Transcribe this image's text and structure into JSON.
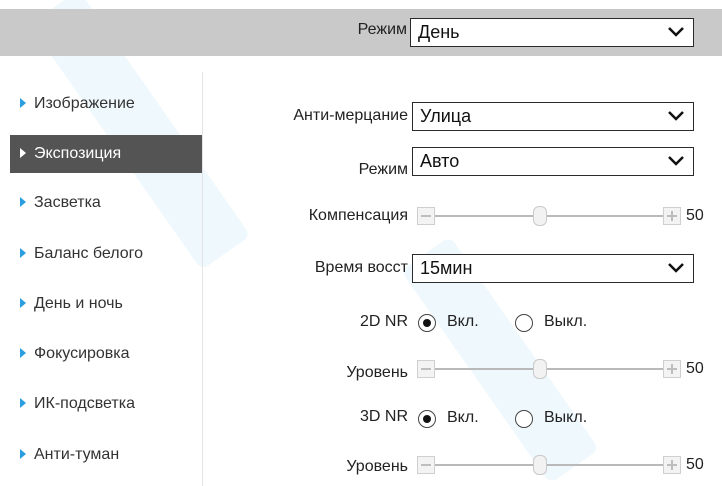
{
  "top": {
    "mode_label": "Режим",
    "mode_value": "День"
  },
  "sidebar": {
    "items": [
      {
        "label": "Изображение",
        "active": false
      },
      {
        "label": "Экспозиция",
        "active": true
      },
      {
        "label": "Засветка",
        "active": false
      },
      {
        "label": "Баланс белого",
        "active": false
      },
      {
        "label": "День и ночь",
        "active": false
      },
      {
        "label": "Фокусировка",
        "active": false
      },
      {
        "label": "ИК-подсветка",
        "active": false
      },
      {
        "label": "Анти-туман",
        "active": false
      }
    ]
  },
  "form": {
    "anti_flicker": {
      "label": "Анти-мерцание",
      "value": "Улица"
    },
    "mode": {
      "label": "Режим",
      "value": "Авто"
    },
    "compensation": {
      "label": "Компенсация",
      "value": "50",
      "level": 50
    },
    "recovery_time": {
      "label": "Время восст",
      "value": "15мин"
    },
    "nr2d": {
      "label": "2D NR",
      "on_label": "Вкл.",
      "off_label": "Выкл.",
      "selected": "on"
    },
    "nr2d_level": {
      "label": "Уровень",
      "value": "50",
      "level": 50
    },
    "nr3d": {
      "label": "3D NR",
      "on_label": "Вкл.",
      "off_label": "Выкл.",
      "selected": "on"
    },
    "nr3d_level": {
      "label": "Уровень",
      "value": "50",
      "level": 50
    }
  },
  "colors": {
    "accent": "#2a9fe0",
    "active_bg": "#545454",
    "topbar_bg": "#c9c9c9"
  },
  "icons": {
    "nav_marker": "triangle-right-icon",
    "dropdown": "chevron-down-icon"
  }
}
